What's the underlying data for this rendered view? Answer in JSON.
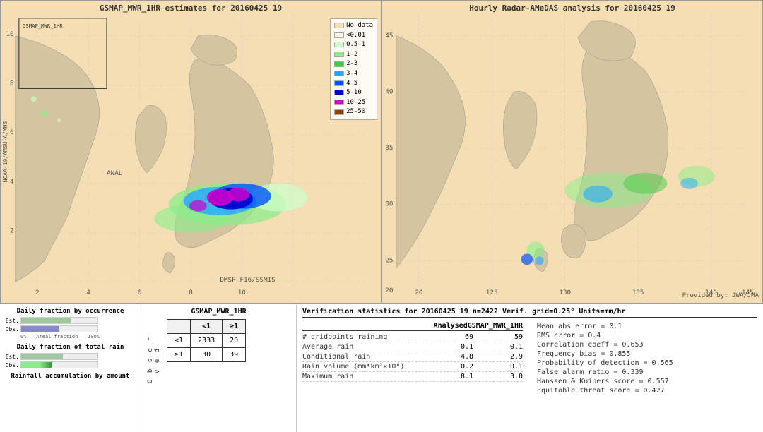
{
  "leftMap": {
    "title": "GSMAP_MWR_1HR estimates for 20160425 19",
    "axisLabel": "NOAA-19/AMSU-A/MHS",
    "bottomLabel": [
      "2",
      "4",
      "6",
      "8",
      "10"
    ],
    "watermark": "DMSP-F16/SSMIS",
    "analLabel": "ANAL",
    "legend": {
      "items": [
        {
          "label": "No data",
          "color": "#f5deb3"
        },
        {
          "label": "<0.01",
          "color": "#fffff0"
        },
        {
          "label": "0.5-1",
          "color": "#ccffcc"
        },
        {
          "label": "1-2",
          "color": "#88ee88"
        },
        {
          "label": "2-3",
          "color": "#44cc44"
        },
        {
          "label": "3-4",
          "color": "#22aaff"
        },
        {
          "label": "4-5",
          "color": "#0055ff"
        },
        {
          "label": "5-10",
          "color": "#0000cc"
        },
        {
          "label": "10-25",
          "color": "#cc00cc"
        },
        {
          "label": "25-50",
          "color": "#884400"
        }
      ]
    }
  },
  "rightMap": {
    "title": "Hourly Radar-AMeDAS analysis for 20160425 19",
    "latLabels": [
      "45",
      "40",
      "35",
      "30",
      "25",
      "20"
    ],
    "lonLabels": [
      "125",
      "130",
      "135",
      "140",
      "145"
    ],
    "watermark": "Provided by: JWA/JMA"
  },
  "bottomLeft": {
    "title1": "Daily fraction by occurrence",
    "title2": "Daily fraction of total rain",
    "title3": "Rainfall accumulation by amount",
    "estLabel": "Est.",
    "obsLabel": "Obs.",
    "axisStart": "0%",
    "axisEnd": "100%",
    "axisLabel": "Areal fraction"
  },
  "contingency": {
    "title": "GSMAP_MWR_1HR",
    "rowLabels": [
      "<1",
      "≥1"
    ],
    "colLabels": [
      "<1",
      "≥1"
    ],
    "observedLabel": "O b s e r v e d",
    "values": [
      [
        2333,
        20
      ],
      [
        30,
        39
      ]
    ]
  },
  "verification": {
    "title": "Verification statistics for 20160425 19  n=2422  Verif. grid=0.25°  Units=mm/hr",
    "columnHeaders": [
      "Analysed",
      "GSMAP_MWR_1HR"
    ],
    "rows": [
      {
        "label": "# gridpoints raining",
        "vals": [
          "69",
          "59"
        ]
      },
      {
        "label": "Average rain",
        "vals": [
          "0.1",
          "0.1"
        ]
      },
      {
        "label": "Conditional rain",
        "vals": [
          "4.8",
          "2.9"
        ]
      },
      {
        "label": "Rain volume (mm*km²×10⁶)",
        "vals": [
          "0.2",
          "0.1"
        ]
      },
      {
        "label": "Maximum rain",
        "vals": [
          "8.1",
          "3.0"
        ]
      }
    ],
    "stats": [
      "Mean abs error = 0.1",
      "RMS error = 0.4",
      "Correlation coeff = 0.653",
      "Frequency bias = 0.855",
      "Probability of detection = 0.565",
      "False alarm ratio = 0.339",
      "Hanssen & Kuipers score = 0.557",
      "Equitable threat score = 0.427"
    ]
  }
}
